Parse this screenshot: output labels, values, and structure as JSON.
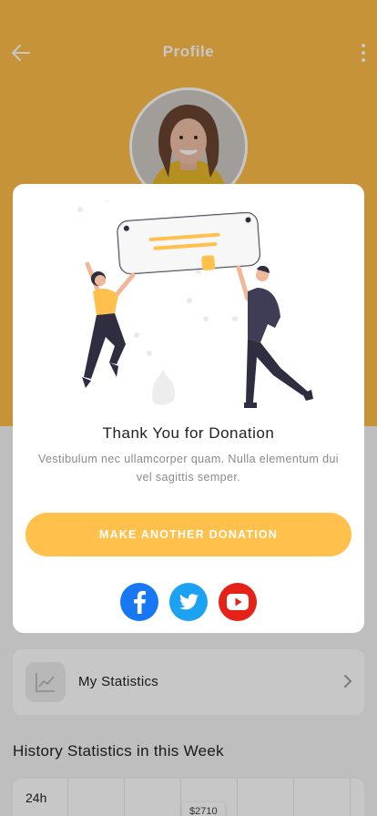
{
  "header": {
    "title": "Profile",
    "back_icon": "arrow-left-icon",
    "more_icon": "more-vertical-icon"
  },
  "profile": {
    "avatar_icon": "profile-photo"
  },
  "stats_card": {
    "icon": "line-chart-icon",
    "label": "My Statistics",
    "chevron_icon": "chevron-right-icon"
  },
  "history": {
    "title": "History Statistics in this Week",
    "period": "24h",
    "value": "$2710"
  },
  "modal": {
    "illustration_icon": "celebration-illustration",
    "title": "Thank You for Donation",
    "message": "Vestibulum nec ullamcorper quam. Nulla elementum dui vel sagittis semper.",
    "cta_label": "MAKE ANOTHER DONATION",
    "socials": [
      {
        "name": "facebook-icon",
        "color": "#1877F2"
      },
      {
        "name": "twitter-icon",
        "color": "#1DA1F2"
      },
      {
        "name": "youtube-icon",
        "color": "#E62117"
      }
    ]
  },
  "colors": {
    "accent": "#FFBD4A",
    "button": "#FFC04C",
    "overlay": "rgba(0,0,0,0.22)"
  }
}
